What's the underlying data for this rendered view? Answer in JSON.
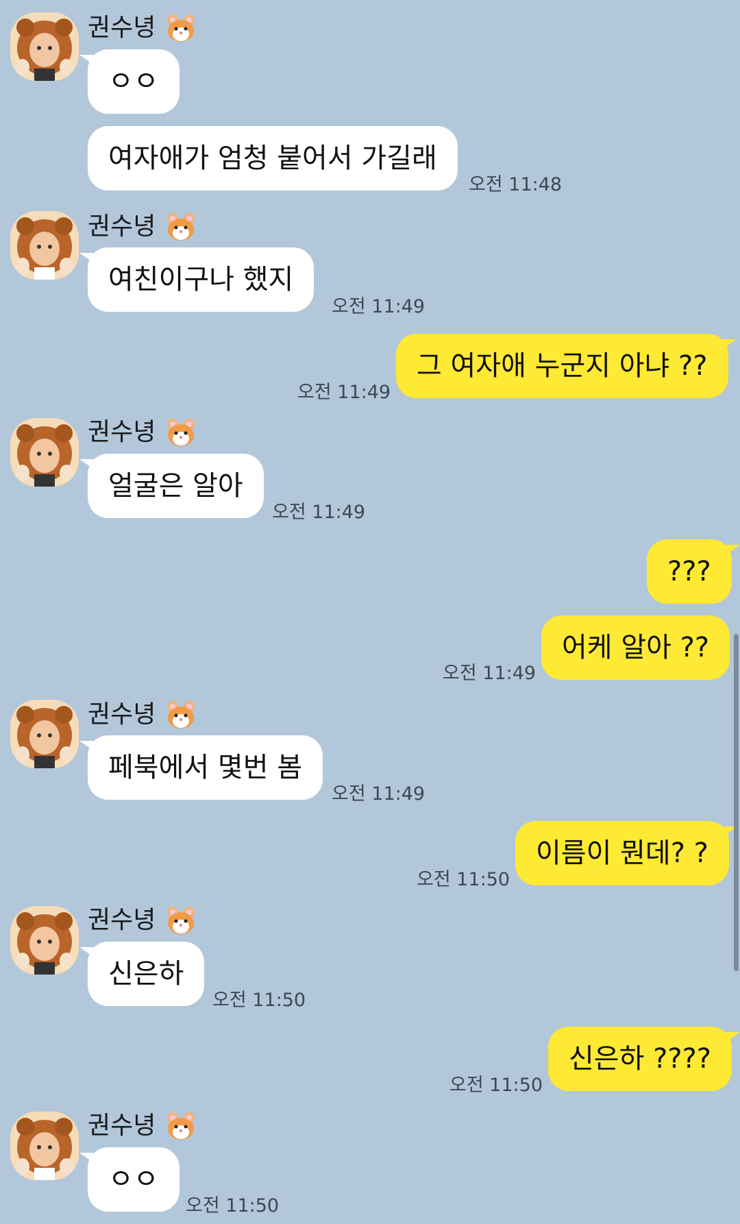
{
  "sender": {
    "name": "권수녕"
  },
  "messages": [
    {
      "from": "them",
      "text": "ㅇㅇ",
      "time": ""
    },
    {
      "from": "them",
      "text": "여자애가 엄청 붙어서 가길래",
      "time": "오전 11:48"
    },
    {
      "from": "them",
      "text": "여친이구나 했지",
      "time": "오전 11:49"
    },
    {
      "from": "me",
      "text": "그 여자애 누군지 아냐 ??",
      "time": "오전 11:49"
    },
    {
      "from": "them",
      "text": "얼굴은 알아",
      "time": "오전 11:49"
    },
    {
      "from": "me",
      "text": "???",
      "time": ""
    },
    {
      "from": "me",
      "text": "어케 알아 ??",
      "time": "오전 11:49"
    },
    {
      "from": "them",
      "text": "페북에서 몇번 봄",
      "time": "오전 11:49"
    },
    {
      "from": "me",
      "text": "이름이 뭔데? ?",
      "time": "오전 11:50"
    },
    {
      "from": "them",
      "text": "신은하",
      "time": "오전 11:50"
    },
    {
      "from": "me",
      "text": "신은하 ????",
      "time": "오전 11:50"
    },
    {
      "from": "them",
      "text": "ㅇㅇ",
      "time": "오전 11:50"
    }
  ],
  "colors": {
    "background": "#b2c7da",
    "incoming_bubble": "#ffffff",
    "outgoing_bubble": "#fee934"
  },
  "icons": {
    "avatar": "profile-photo-lion-hood",
    "name_emoji": "hamster-icon"
  }
}
